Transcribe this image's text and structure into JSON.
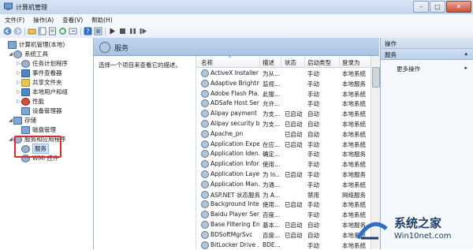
{
  "window": {
    "title": "计算机管理",
    "controls": [
      "minimize",
      "maximize",
      "close"
    ]
  },
  "menu": [
    "文件(F)",
    "操作(A)",
    "查看(V)",
    "帮助(H)"
  ],
  "tree": [
    {
      "label": "计算机管理(本地)",
      "icon": "computer-icon",
      "level": 0,
      "expander": ""
    },
    {
      "label": "系统工具",
      "icon": "folder-icon",
      "level": 1,
      "expander": "◢"
    },
    {
      "label": "任务计划程序",
      "icon": "clock-icon",
      "level": 2,
      "expander": "▷"
    },
    {
      "label": "事件查看器",
      "icon": "event-icon",
      "level": 2,
      "expander": "▷"
    },
    {
      "label": "共享文件夹",
      "icon": "shared-folder-icon",
      "level": 2,
      "expander": "▷"
    },
    {
      "label": "本地用户和组",
      "icon": "users-icon",
      "level": 2,
      "expander": "▷"
    },
    {
      "label": "性能",
      "icon": "performance-icon",
      "level": 2,
      "expander": "▷"
    },
    {
      "label": "设备管理器",
      "icon": "device-icon",
      "level": 2,
      "expander": ""
    },
    {
      "label": "存储",
      "icon": "storage-icon",
      "level": 1,
      "expander": "◢"
    },
    {
      "label": "磁盘管理",
      "icon": "disk-icon",
      "level": 2,
      "expander": ""
    },
    {
      "label": "服务和应用程序",
      "icon": "apps-icon",
      "level": 1,
      "expander": "◢"
    },
    {
      "label": "服务",
      "icon": "services-icon",
      "level": 2,
      "expander": "",
      "selected": true
    },
    {
      "label": "WMI 控件",
      "icon": "wmi-icon",
      "level": 2,
      "expander": ""
    }
  ],
  "panel": {
    "title": "服务",
    "description": "选择一个项目来查看它的描述。"
  },
  "columns": [
    "名称",
    "描述",
    "状态",
    "启动类型",
    "登录为"
  ],
  "services": [
    {
      "name": "ActiveX Installer ...",
      "desc": "为从...",
      "status": "",
      "startup": "手动",
      "logon": "本地系统"
    },
    {
      "name": "Adaptive Brightn...",
      "desc": "监视...",
      "status": "",
      "startup": "手动",
      "logon": "本地服务"
    },
    {
      "name": "Adobe Flash Pla...",
      "desc": "此服...",
      "status": "",
      "startup": "手动",
      "logon": "本地系统"
    },
    {
      "name": "ADSafe Host Ser...",
      "desc": "允许...",
      "status": "",
      "startup": "手动",
      "logon": "本地系统"
    },
    {
      "name": "Alipay payment ...",
      "desc": "为支...",
      "status": "已启动",
      "startup": "自动",
      "logon": "本地系统"
    },
    {
      "name": "Alipay security b...",
      "desc": "为支...",
      "status": "已启动",
      "startup": "自动",
      "logon": "本地系统"
    },
    {
      "name": "Apache_pn",
      "desc": "",
      "status": "已启动",
      "startup": "自动",
      "logon": "本地系统"
    },
    {
      "name": "Application Expe...",
      "desc": "在应...",
      "status": "已启动",
      "startup": "手动",
      "logon": "本地系统"
    },
    {
      "name": "Application Iden...",
      "desc": "确定...",
      "status": "",
      "startup": "手动",
      "logon": "本地服务"
    },
    {
      "name": "Application Infor...",
      "desc": "使用...",
      "status": "",
      "startup": "手动",
      "logon": "本地系统"
    },
    {
      "name": "Application Laye...",
      "desc": "为 In...",
      "status": "已启动",
      "startup": "手动",
      "logon": "本地服务"
    },
    {
      "name": "Application Man...",
      "desc": "为通...",
      "status": "",
      "startup": "手动",
      "logon": "本地系统"
    },
    {
      "name": "ASP.NET 状态服务",
      "desc": "为 A...",
      "status": "",
      "startup": "禁用",
      "logon": "网络服务"
    },
    {
      "name": "Background Inte...",
      "desc": "使用...",
      "status": "已启动",
      "startup": "手动",
      "logon": "本地系统"
    },
    {
      "name": "Baidu Player Ser...",
      "desc": "百度...",
      "status": "",
      "startup": "手动",
      "logon": "本地系统"
    },
    {
      "name": "Base Filtering En...",
      "desc": "基本...",
      "status": "已启动",
      "startup": "自动",
      "logon": "本地服务"
    },
    {
      "name": "BDSoftMgrSvc",
      "desc": "百度...",
      "status": "已启动",
      "startup": "自动",
      "logon": "本地系统"
    },
    {
      "name": "BitLocker Drive ...",
      "desc": "BDE...",
      "status": "",
      "startup": "手动",
      "logon": "本地系统"
    }
  ],
  "actions": {
    "header": "操作",
    "section": "服务",
    "item": "更多操作"
  },
  "watermark": {
    "title": "系统之家",
    "url": "Win10net.com"
  }
}
